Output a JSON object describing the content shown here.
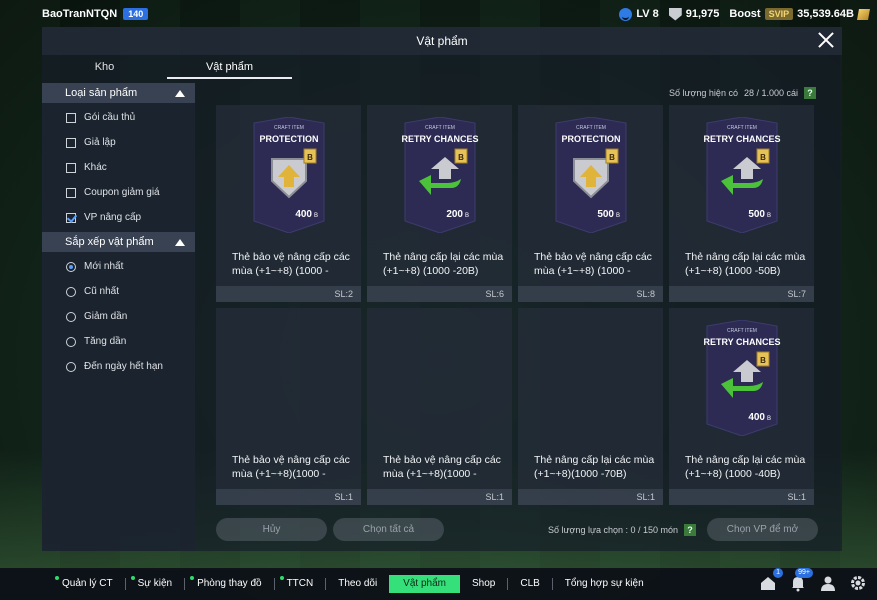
{
  "user": {
    "name": "BaoTranNTQN",
    "level_badge": "140"
  },
  "stats": {
    "lv": "LV 8",
    "points": "91,975",
    "boost_label": "Boost",
    "vip": "SVIP",
    "coins": "35,539.64B"
  },
  "modal": {
    "title": "Vật phẩm"
  },
  "tabs": [
    {
      "label": "Kho",
      "active": false
    },
    {
      "label": "Vật phẩm",
      "active": true
    }
  ],
  "sidebar": {
    "type_section": {
      "title": "Loại sản phẩm",
      "items": [
        {
          "label": "Gói cầu thủ",
          "checked": false
        },
        {
          "label": "Giả lập",
          "checked": false
        },
        {
          "label": "Khác",
          "checked": false
        },
        {
          "label": "Coupon giảm giá",
          "checked": false
        },
        {
          "label": "VP nâng cấp",
          "checked": true
        }
      ]
    },
    "sort_section": {
      "title": "Sắp xếp vật phẩm",
      "items": [
        {
          "label": "Mới nhất",
          "checked": true
        },
        {
          "label": "Cũ nhất",
          "checked": false
        },
        {
          "label": "Giảm dần",
          "checked": false
        },
        {
          "label": "Tăng dần",
          "checked": false
        },
        {
          "label": "Đến ngày hết hạn",
          "checked": false
        }
      ]
    }
  },
  "count": {
    "label": "Số lượng hiện có",
    "value": "28 / 1.000 cái",
    "help": "?"
  },
  "cards": [
    {
      "kind": "protection",
      "art_title": "PROTECTION",
      "craft": "CRAFT ITEM",
      "value": "400",
      "unit": "B",
      "name": "Thẻ bảo vệ nâng cấp các mùa (+1~+8) (1000 -",
      "sl": "SL:2"
    },
    {
      "kind": "retry",
      "art_title": "RETRY CHANCES",
      "craft": "CRAFT ITEM",
      "value": "200",
      "unit": "B",
      "name": "Thẻ nâng cấp lại các mùa (+1~+8) (1000 -20B)",
      "sl": "SL:6"
    },
    {
      "kind": "protection",
      "art_title": "PROTECTION",
      "craft": "CRAFT ITEM",
      "value": "500",
      "unit": "B",
      "name": "Thẻ bảo vệ nâng cấp các mùa (+1~+8) (1000 -",
      "sl": "SL:8"
    },
    {
      "kind": "retry",
      "art_title": "RETRY CHANCES",
      "craft": "CRAFT ITEM",
      "value": "500",
      "unit": "B",
      "name": "Thẻ nâng cấp lại các mùa (+1~+8) (1000 -50B)",
      "sl": "SL:7"
    },
    {
      "kind": "none",
      "name": "Thẻ bảo vệ nâng cấp các mùa (+1~+8)(1000 -",
      "sl": "SL:1"
    },
    {
      "kind": "none",
      "name": "Thẻ bảo vệ nâng cấp các mùa (+1~+8)(1000 -",
      "sl": "SL:1"
    },
    {
      "kind": "none",
      "name": "Thẻ nâng cấp lại các mùa (+1~+8)(1000 -70B)",
      "sl": "SL:1"
    },
    {
      "kind": "retry",
      "art_title": "RETRY CHANCES",
      "craft": "CRAFT ITEM",
      "value": "400",
      "unit": "B",
      "name": "Thẻ nâng cấp lại các mùa (+1~+8) (1000 -40B)",
      "sl": "SL:1"
    }
  ],
  "actions": {
    "cancel": "Hủy",
    "select_all": "Chọn tất cả",
    "selection": "Số lượng lựa chọn : 0 / 150 món",
    "help": "?",
    "open": "Chọn VP để mở"
  },
  "bottom_nav": [
    {
      "label": "Quản lý CT",
      "dot": true,
      "active": false
    },
    {
      "label": "Sự kiện",
      "dot": true,
      "active": false
    },
    {
      "label": "Phòng thay đồ",
      "dot": true,
      "active": false
    },
    {
      "label": "TTCN",
      "dot": true,
      "active": false
    },
    {
      "label": "Theo dõi",
      "dot": false,
      "active": false
    },
    {
      "label": "Vật phẩm",
      "dot": false,
      "active": true
    },
    {
      "label": "Shop",
      "dot": false,
      "active": false
    },
    {
      "label": "CLB",
      "dot": false,
      "active": false
    },
    {
      "label": "Tổng hợp sự kiện",
      "dot": false,
      "active": false
    }
  ],
  "nav_icons": {
    "home_badge": "1",
    "bell_badge": "99+"
  },
  "colors": {
    "accent_green": "#35e07a",
    "card_bg": "#262e3a",
    "card_art": "#2b2a52"
  }
}
